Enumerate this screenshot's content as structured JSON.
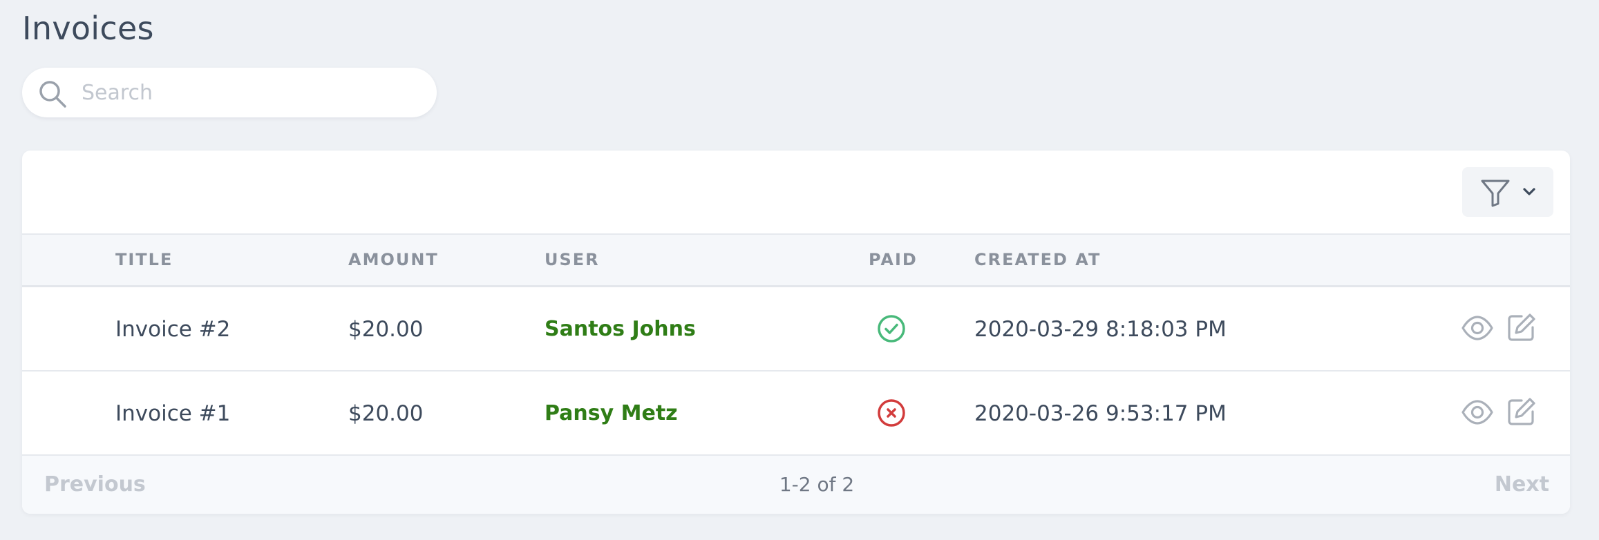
{
  "page": {
    "title": "Invoices"
  },
  "search": {
    "placeholder": "Search",
    "value": ""
  },
  "table": {
    "columns": [
      "TITLE",
      "AMOUNT",
      "USER",
      "PAID",
      "CREATED AT"
    ],
    "rows": [
      {
        "title": "Invoice #2",
        "amount": "$20.00",
        "user": "Santos Johns",
        "paid": true,
        "paid_icon": "check-circle-icon",
        "created_at": "2020-03-29 8:18:03 PM"
      },
      {
        "title": "Invoice #1",
        "amount": "$20.00",
        "user": "Pansy Metz",
        "paid": false,
        "paid_icon": "x-circle-icon",
        "created_at": "2020-03-26 9:53:17 PM"
      }
    ]
  },
  "pagination": {
    "previous": "Previous",
    "info": "1-2 of 2",
    "next": "Next"
  },
  "colors": {
    "user_link": "#2f7d16",
    "paid_true": "#48b97a",
    "paid_false": "#d23c3c",
    "background": "#eef1f5"
  }
}
